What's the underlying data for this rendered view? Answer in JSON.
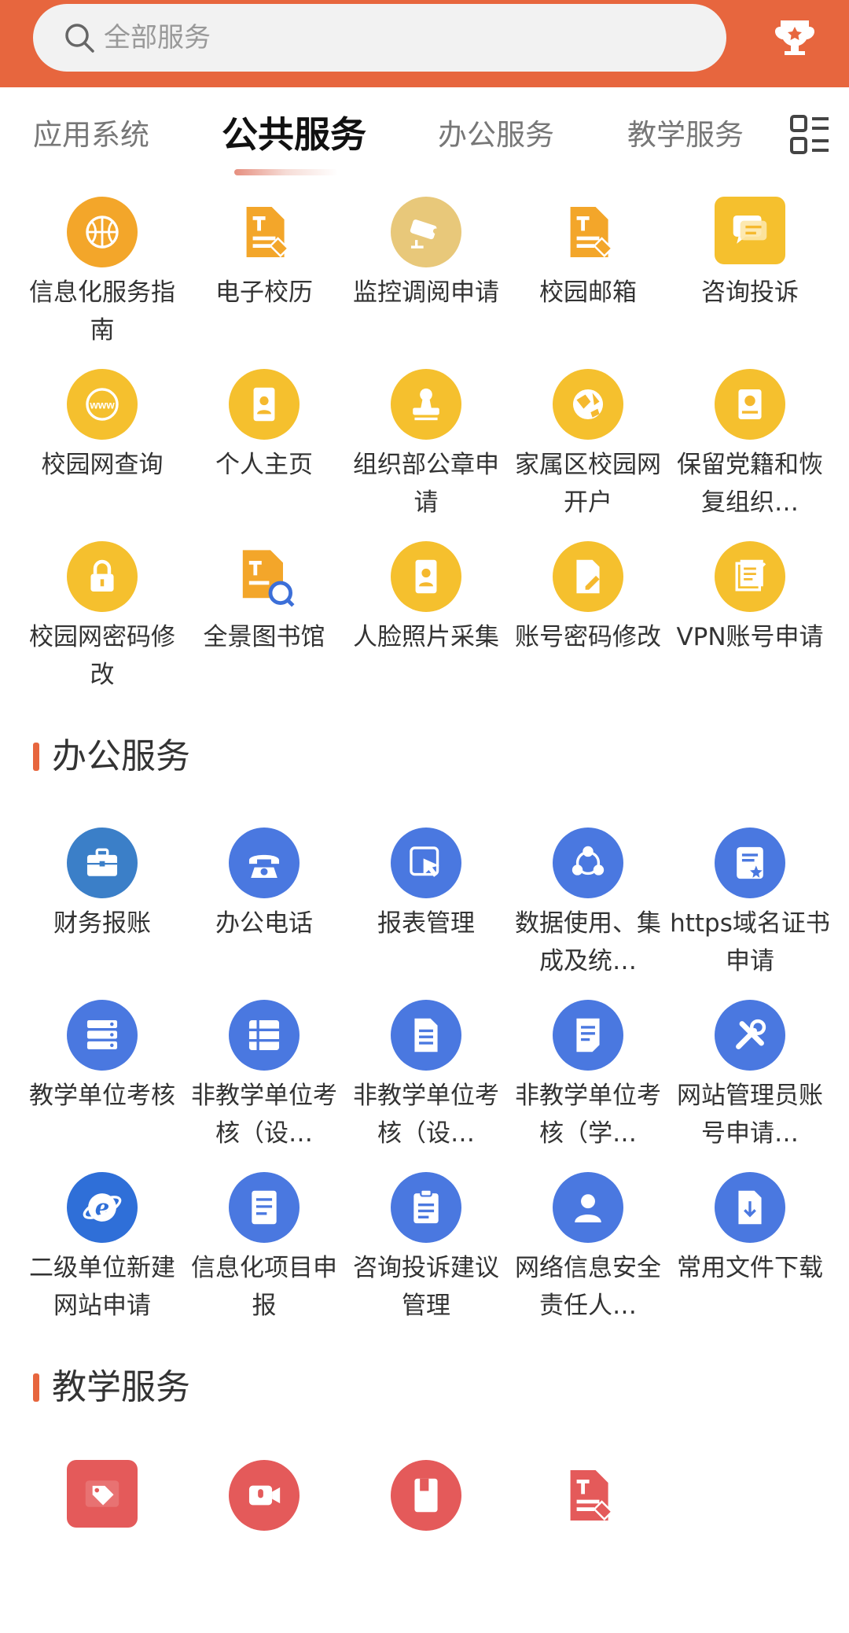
{
  "header": {
    "search_placeholder": "全部服务",
    "trophy_icon": "trophy-icon",
    "accent": "#e7663e"
  },
  "tabs": [
    {
      "label": "应用系统",
      "active": false
    },
    {
      "label": "公共服务",
      "active": true
    },
    {
      "label": "办公服务",
      "active": false
    },
    {
      "label": "教学服务",
      "active": false
    }
  ],
  "public_services": {
    "items": [
      {
        "label": "信息化服务指南",
        "icon": "basketball-icon"
      },
      {
        "label": "电子校历",
        "icon": "document-edit-icon"
      },
      {
        "label": "监控调阅申请",
        "icon": "camera-icon"
      },
      {
        "label": "校园邮箱",
        "icon": "document-edit-icon"
      },
      {
        "label": "咨询投诉",
        "icon": "chat-icon"
      },
      {
        "label": "校园网查询",
        "icon": "globe-www-icon"
      },
      {
        "label": "个人主页",
        "icon": "id-card-icon"
      },
      {
        "label": "组织部公章申请",
        "icon": "stamp-icon"
      },
      {
        "label": "家属区校园网开户",
        "icon": "network-globe-icon"
      },
      {
        "label": "保留党籍和恢复组织…",
        "icon": "badge-book-icon"
      },
      {
        "label": "校园网密码修改",
        "icon": "lock-icon"
      },
      {
        "label": "全景图书馆",
        "icon": "document-search-icon"
      },
      {
        "label": "人脸照片采集",
        "icon": "id-card-icon"
      },
      {
        "label": "账号密码修改",
        "icon": "file-edit-icon"
      },
      {
        "label": "VPN账号申请",
        "icon": "notes-edit-icon"
      }
    ]
  },
  "office_services": {
    "title": "办公服务",
    "items": [
      {
        "label": "财务报账",
        "icon": "briefcase-icon"
      },
      {
        "label": "办公电话",
        "icon": "telephone-icon"
      },
      {
        "label": "报表管理",
        "icon": "cursor-click-icon"
      },
      {
        "label": "数据使用、集成及统…",
        "icon": "share-nodes-icon"
      },
      {
        "label": "https域名证书申请",
        "icon": "certificate-icon"
      },
      {
        "label": "教学单位考核",
        "icon": "server-icon"
      },
      {
        "label": "非教学单位考核（设…",
        "icon": "list-stack-icon"
      },
      {
        "label": "非教学单位考核（设…",
        "icon": "document-lines-icon"
      },
      {
        "label": "非教学单位考核（学…",
        "icon": "document-note-icon"
      },
      {
        "label": "网站管理员账号申请…",
        "icon": "tools-icon"
      },
      {
        "label": "二级单位新建网站申请",
        "icon": "browser-e-icon"
      },
      {
        "label": "信息化项目申报",
        "icon": "checklist-icon"
      },
      {
        "label": "咨询投诉建议管理",
        "icon": "clipboard-icon"
      },
      {
        "label": "网络信息安全责任人…",
        "icon": "person-icon"
      },
      {
        "label": "常用文件下载",
        "icon": "file-download-icon"
      }
    ]
  },
  "teaching_services": {
    "title": "教学服务",
    "items": [
      {
        "label": "",
        "icon": "tag-icon"
      },
      {
        "label": "",
        "icon": "video-mic-icon"
      },
      {
        "label": "",
        "icon": "book-icon"
      },
      {
        "label": "",
        "icon": "document-edit-icon"
      }
    ]
  }
}
